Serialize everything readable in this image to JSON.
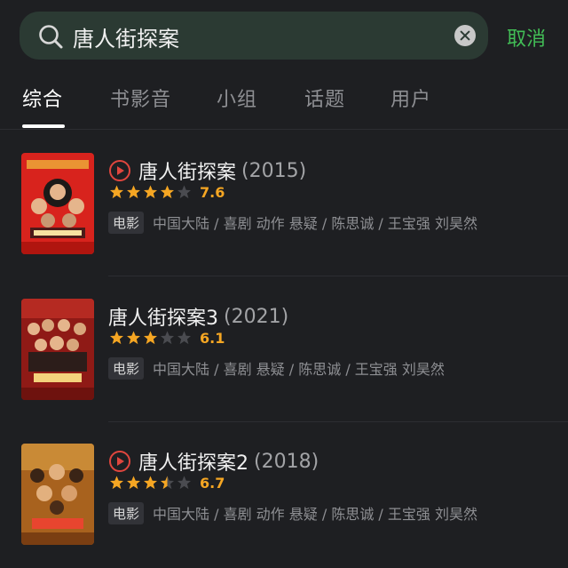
{
  "search": {
    "query": "唐人街探案",
    "cancel_label": "取消"
  },
  "tabs": [
    {
      "label": "综合",
      "active": true
    },
    {
      "label": "书影音",
      "active": false
    },
    {
      "label": "小组",
      "active": false
    },
    {
      "label": "话题",
      "active": false
    },
    {
      "label": "用户",
      "active": false
    }
  ],
  "results": [
    {
      "title": "唐人街探案",
      "year": "(2015)",
      "has_play_icon": true,
      "stars": 4,
      "score": "7.6",
      "badge": "电影",
      "meta": "中国大陆 / 喜剧 动作 悬疑 / 陈思诚 / 王宝强 刘昊然"
    },
    {
      "title": "唐人街探案3",
      "year": "(2021)",
      "has_play_icon": false,
      "stars": 3,
      "score": "6.1",
      "badge": "电影",
      "meta": "中国大陆 / 喜剧 悬疑 / 陈思诚 / 王宝强 刘昊然"
    },
    {
      "title": "唐人街探案2",
      "year": "(2018)",
      "has_play_icon": true,
      "stars": 3.5,
      "score": "6.7",
      "badge": "电影",
      "meta": "中国大陆 / 喜剧 动作 悬疑 / 陈思诚 / 王宝强 刘昊然"
    }
  ],
  "colors": {
    "accent_green": "#42bd56",
    "star_gold": "#f5a623",
    "star_empty": "#4a4b50",
    "play_red": "#e0463e"
  }
}
